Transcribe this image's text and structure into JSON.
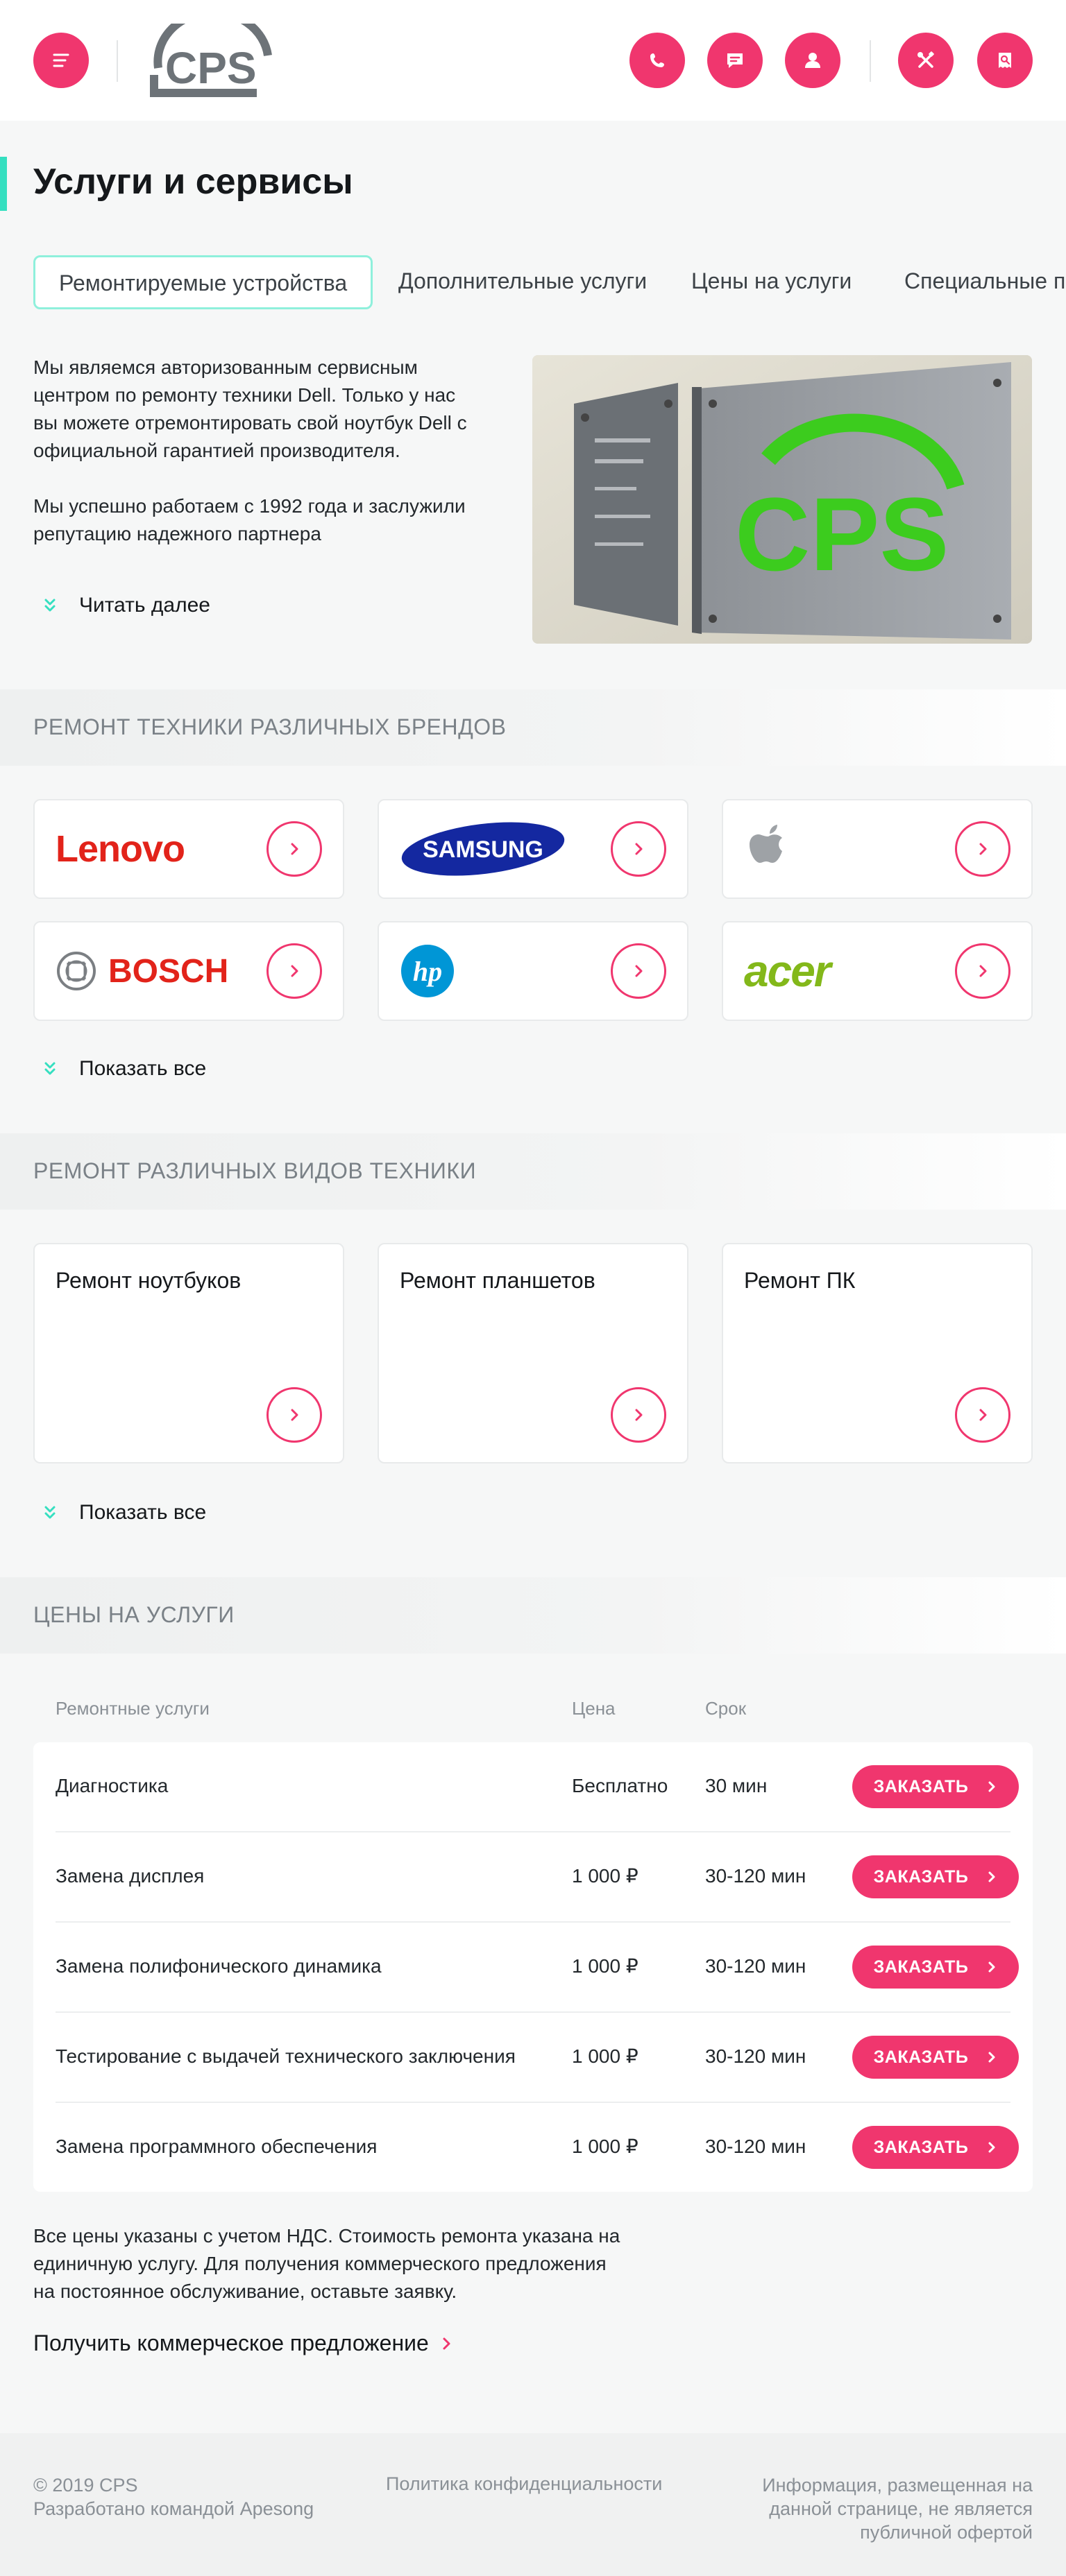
{
  "header": {
    "logo_text": "CPS",
    "icons": [
      "menu-icon",
      "phone-icon",
      "chat-icon",
      "user-icon",
      "tools-icon",
      "receipt-icon"
    ]
  },
  "page_title": "Услуги и сервисы",
  "tabs": [
    {
      "label": "Ремонтируемые устройства",
      "active": true
    },
    {
      "label": "Дополнительные услуги",
      "active": false
    },
    {
      "label": "Цены на услуги",
      "active": false
    },
    {
      "label": "Специальные предложения",
      "active": false
    }
  ],
  "intro": {
    "paragraph1": "Мы являемся авторизованным сервисным центром по ремонту техники Dell. Только у нас вы можете отремонтировать свой ноутбук Dell с официальной гарантией производителя.",
    "paragraph2": "Мы успешно работаем с 1992 года и заслужили репутацию надежного партнера",
    "read_more": "Читать далее",
    "photo_sign_text": "CPS"
  },
  "brands_section": {
    "heading": "РЕМОНТ ТЕХНИКИ РАЗЛИЧНЫХ БРЕНДОВ",
    "brands": [
      "Lenovo",
      "SAMSUNG",
      "Apple",
      "BOSCH",
      "hp",
      "acer"
    ],
    "show_all": "Показать все"
  },
  "types_section": {
    "heading": "РЕМОНТ РАЗЛИЧНЫХ ВИДОВ ТЕХНИКИ",
    "items": [
      "Ремонт ноутбуков",
      "Ремонт планшетов",
      "Ремонт ПК"
    ],
    "show_all": "Показать все"
  },
  "prices_section": {
    "heading": "ЦЕНЫ НА УСЛУГИ",
    "columns": {
      "service": "Ремонтные услуги",
      "price": "Цена",
      "term": "Срок"
    },
    "rows": [
      {
        "service": "Диагностика",
        "price": "Бесплатно",
        "term": "30 мин",
        "button": "ЗАКАЗАТЬ"
      },
      {
        "service": "Замена дисплея",
        "price": "1 000 ₽",
        "term": "30-120 мин",
        "button": "ЗАКАЗАТЬ"
      },
      {
        "service": "Замена полифонического динамика",
        "price": "1 000 ₽",
        "term": "30-120 мин",
        "button": "ЗАКАЗАТЬ"
      },
      {
        "service": "Тестирование с выдачей технического заключения",
        "price": "1 000 ₽",
        "term": "30-120 мин",
        "button": "ЗАКАЗАТЬ"
      },
      {
        "service": "Замена программного обеспечения",
        "price": "1 000 ₽",
        "term": "30-120 мин",
        "button": "ЗАКАЗАТЬ"
      }
    ],
    "note": "Все цены указаны с учетом НДС. Стоимость ремонта указана на единичную услугу. Для получения коммерческого предложения на постоянное обслуживание, оставьте заявку.",
    "offer_link": "Получить коммерческое предложение"
  },
  "footer": {
    "copyright": "© 2019 CPS",
    "developer": "Разработано командой Apesong",
    "policy": "Политика конфиденциальности",
    "info": "Информация, размещенная на данной странице, не является публичной офертой"
  },
  "colors": {
    "accent": "#f0366e",
    "teal": "#35dfc0",
    "green": "#3ccc1e"
  }
}
